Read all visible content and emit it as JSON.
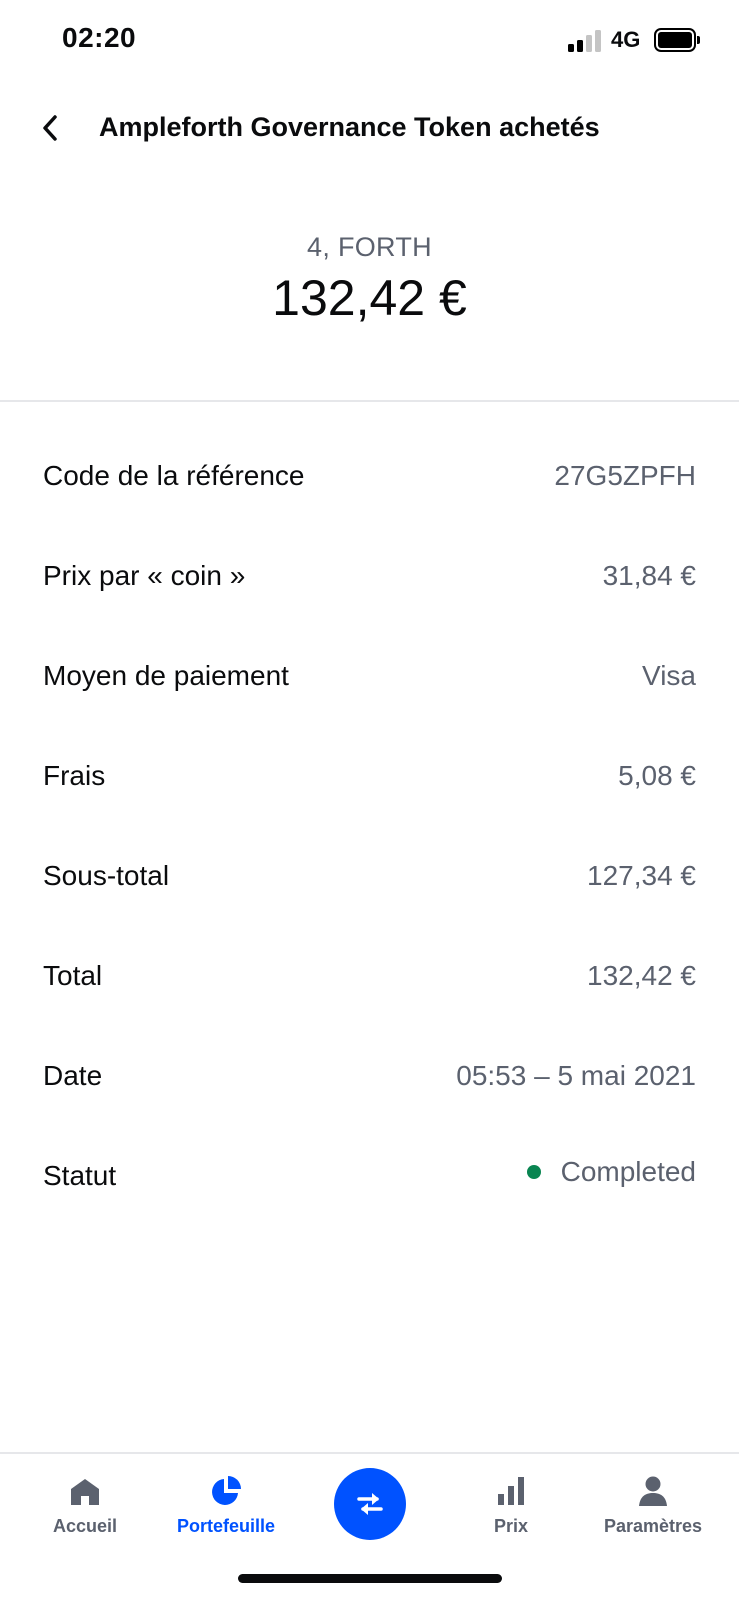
{
  "status_bar": {
    "time": "02:20",
    "network": "4G"
  },
  "header": {
    "title": "Ampleforth Governance Token achetés"
  },
  "summary": {
    "crypto_amount": "4, FORTH",
    "fiat_amount": "132,42 €"
  },
  "details": [
    {
      "label": "Code de la référence",
      "value": "27G5ZPFH"
    },
    {
      "label": "Prix par « coin »",
      "value": "31,84 €"
    },
    {
      "label": "Moyen de paiement",
      "value": "Visa"
    },
    {
      "label": "Frais",
      "value": "5,08 €"
    },
    {
      "label": "Sous-total",
      "value": "127,34 €"
    },
    {
      "label": "Total",
      "value": "132,42 €"
    },
    {
      "label": "Date",
      "value": "05:53 – 5 mai 2021"
    },
    {
      "label": "Statut",
      "value": "Completed"
    }
  ],
  "nav": {
    "home": "Accueil",
    "portfolio": "Portefeuille",
    "prices": "Prix",
    "settings": "Paramètres",
    "active": "portfolio"
  },
  "colors": {
    "accent": "#0052ff",
    "status_completed": "#098551",
    "secondary_text": "#5b616e"
  },
  "icons": {
    "back": "chevron-left-icon",
    "home": "house-icon",
    "portfolio": "pie-chart-icon",
    "trade": "swap-arrows-icon",
    "prices": "bar-chart-icon",
    "settings": "person-icon"
  }
}
